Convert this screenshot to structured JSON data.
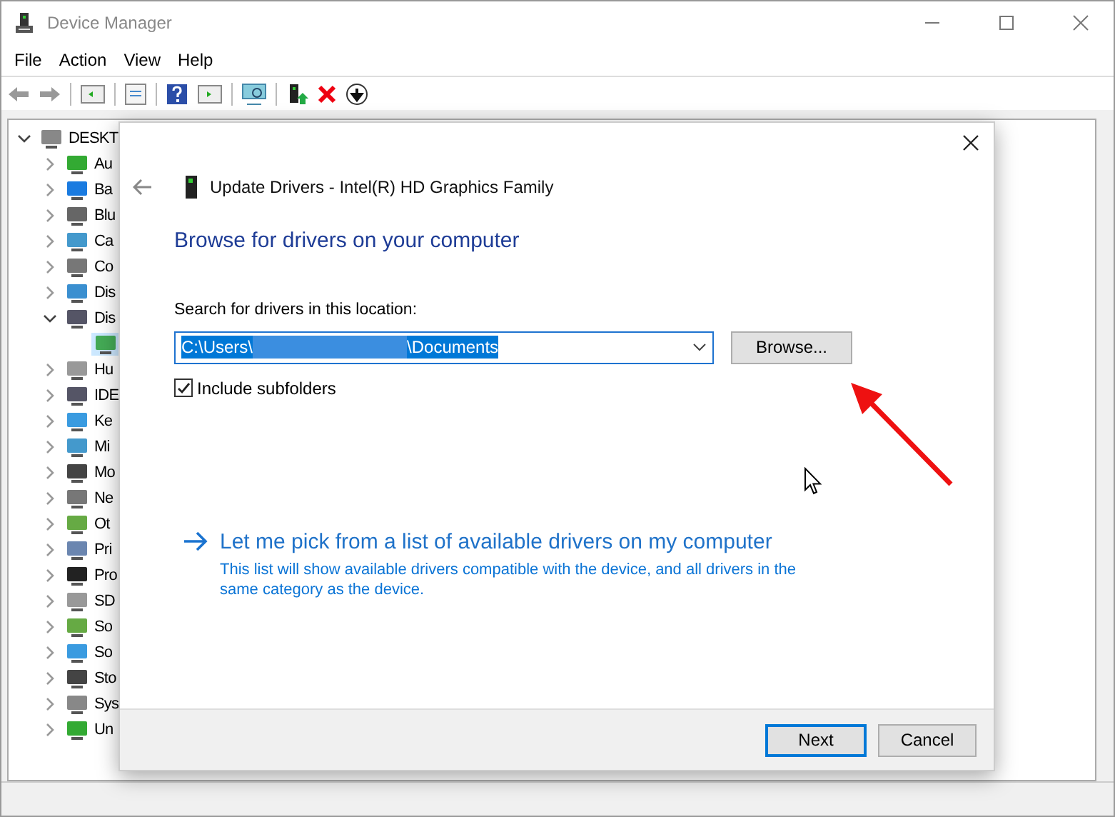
{
  "window": {
    "title": "Device Manager"
  },
  "menu": [
    "File",
    "Action",
    "View",
    "Help"
  ],
  "tree": {
    "label": "DESKT",
    "expanded": true,
    "children": [
      {
        "label": "Au",
        "expanded": false
      },
      {
        "label": "Ba",
        "expanded": false
      },
      {
        "label": "Blu",
        "expanded": false
      },
      {
        "label": "Ca",
        "expanded": false
      },
      {
        "label": "Co",
        "expanded": false
      },
      {
        "label": "Dis",
        "expanded": false
      },
      {
        "label": "Dis",
        "expanded": true,
        "children": [
          {
            "selected": true
          }
        ]
      },
      {
        "label": "Hu",
        "expanded": false
      },
      {
        "label": "IDE",
        "expanded": false
      },
      {
        "label": "Ke",
        "expanded": false
      },
      {
        "label": "Mi",
        "expanded": false
      },
      {
        "label": "Mo",
        "expanded": false
      },
      {
        "label": "Ne",
        "expanded": false
      },
      {
        "label": "Ot",
        "expanded": false
      },
      {
        "label": "Pri",
        "expanded": false
      },
      {
        "label": "Pro",
        "expanded": false
      },
      {
        "label": "SD",
        "expanded": false
      },
      {
        "label": "So",
        "expanded": false
      },
      {
        "label": "So",
        "expanded": false
      },
      {
        "label": "Sto",
        "expanded": false
      },
      {
        "label": "Sys",
        "expanded": false
      },
      {
        "label": "Un",
        "expanded": false
      }
    ]
  },
  "dialog": {
    "title": "Update Drivers - Intel(R) HD Graphics Family",
    "heading": "Browse for drivers on your computer",
    "location_label": "Search for drivers in this location:",
    "path_start": "C:\\Users\\",
    "path_end": "\\Documents",
    "browse_button": "Browse...",
    "include_subfolders": {
      "label": "Include subfolders",
      "checked": true
    },
    "pick_link": {
      "title": "Let me pick from a list of available drivers on my computer",
      "description": "This list will show available drivers compatible with the device, and all drivers in the same category as the device."
    },
    "buttons": [
      {
        "label": "Next",
        "default": true
      },
      {
        "label": "Cancel",
        "default": false
      }
    ]
  }
}
